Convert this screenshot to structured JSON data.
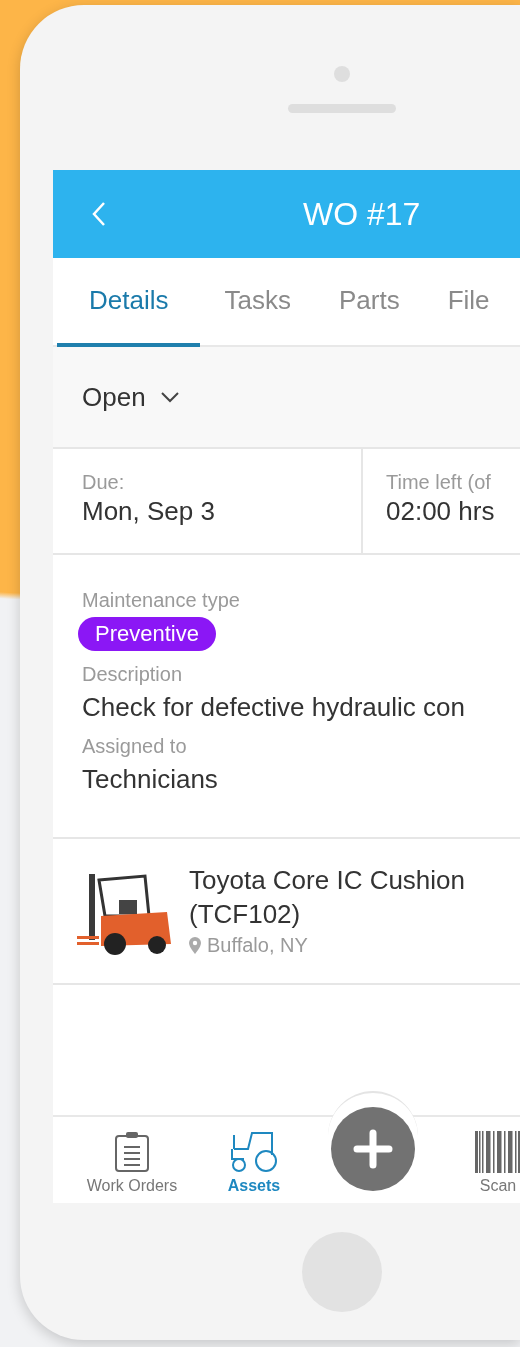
{
  "header": {
    "title": "WO #17"
  },
  "tabs": [
    {
      "label": "Details",
      "selected": true
    },
    {
      "label": "Tasks",
      "selected": false
    },
    {
      "label": "Parts",
      "selected": false
    },
    {
      "label": "File",
      "selected": false
    }
  ],
  "status": {
    "value": "Open"
  },
  "due": {
    "label": "Due:",
    "value": "Mon, Sep 3"
  },
  "time_left": {
    "label": "Time left (of",
    "value": "02:00 hrs"
  },
  "fields": [
    {
      "kind": "tag",
      "label": "Maintenance type",
      "value": "Preventive"
    },
    {
      "kind": "text",
      "label": "Description",
      "value": "Check for defective hydraulic con"
    },
    {
      "kind": "text",
      "label": "Assigned to",
      "value": "Technicians"
    }
  ],
  "asset": {
    "name": "Toyota Core IC Cushion",
    "code": "(TCF102)",
    "location": "Buffalo, NY"
  },
  "nav": [
    {
      "kind": "clipboard",
      "label": "Work Orders",
      "selected": false
    },
    {
      "kind": "tractor",
      "label": "Assets",
      "selected": true
    },
    {
      "kind": "add"
    },
    {
      "kind": "barcode",
      "label": "Scan",
      "selected": false
    }
  ]
}
